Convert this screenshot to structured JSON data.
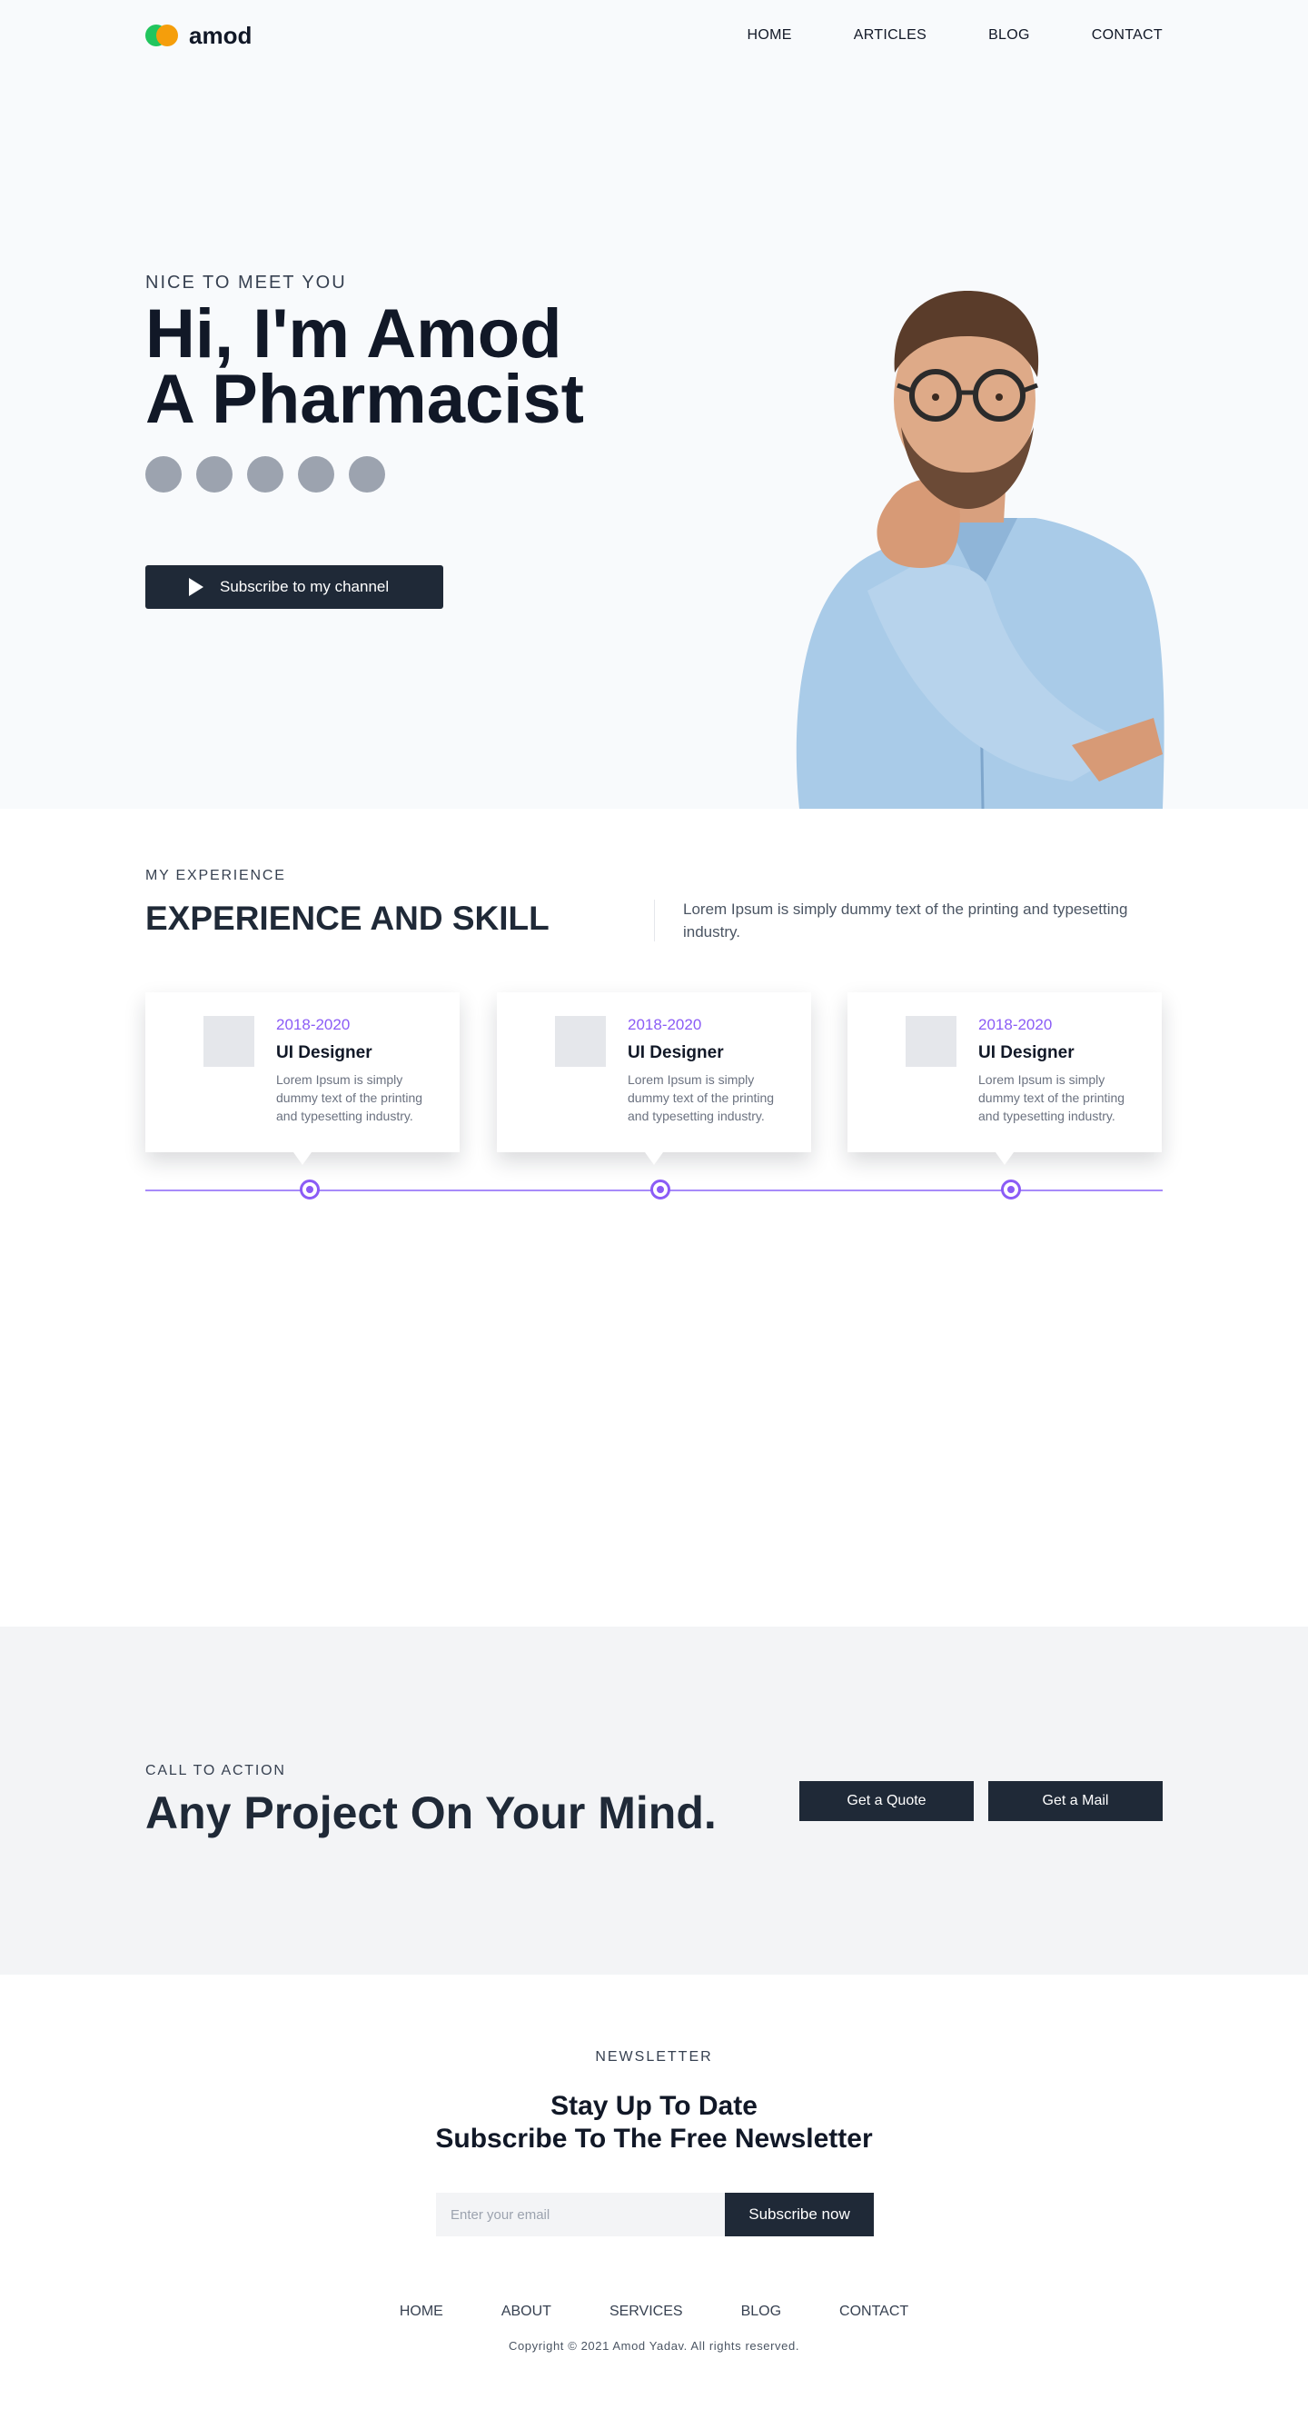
{
  "header": {
    "logo_text": "amod",
    "nav": [
      "HOME",
      "ARTICLES",
      "BLOG",
      "CONTACT"
    ]
  },
  "hero": {
    "kicker": "NICE TO MEET YOU",
    "title_line1": "Hi, I'm Amod",
    "title_line2": "A Pharmacist",
    "social_icons": [
      "social-icon-1",
      "social-icon-2",
      "social-icon-3",
      "social-icon-4",
      "social-icon-5"
    ],
    "cta_label": "Subscribe to my channel",
    "cta_icon": "play-icon"
  },
  "experience": {
    "kicker": "MY EXPERIENCE",
    "title": "EXPERIENCE AND SKILL",
    "description": "Lorem Ipsum is simply dummy text of the printing and typesetting industry.",
    "cards": [
      {
        "year": "2018-2020",
        "role": "UI Designer",
        "text": "Lorem Ipsum is simply dummy text of the printing and typesetting industry."
      },
      {
        "year": "2018-2020",
        "role": "UI Designer",
        "text": "Lorem Ipsum is simply dummy text of the printing and typesetting industry."
      },
      {
        "year": "2018-2020",
        "role": "UI Designer",
        "text": "Lorem Ipsum is simply dummy text of the printing and typesetting industry."
      }
    ]
  },
  "call_to_action": {
    "kicker": "CALL TO ACTION",
    "title": "Any Project On Your Mind.",
    "quote_button": "Get a Quote",
    "mail_button": "Get a Mail"
  },
  "newsletter": {
    "kicker": "NEWSLETTER",
    "title_line1": "Stay Up To Date",
    "title_line2": "Subscribe To The Free Newsletter",
    "email_placeholder": "Enter your email",
    "email_value": "",
    "subscribe_label": "Subscribe now"
  },
  "footer": {
    "nav": [
      "HOME",
      "ABOUT",
      "SERVICES",
      "BLOG",
      "CONTACT"
    ],
    "copyright": "Copyright © 2021 Amod Yadav. All rights reserved."
  },
  "colors": {
    "accent": "#8b5cf6",
    "dark": "#1f2937",
    "hero_bg": "#f8fafc",
    "cta_bg": "#f3f4f6"
  }
}
